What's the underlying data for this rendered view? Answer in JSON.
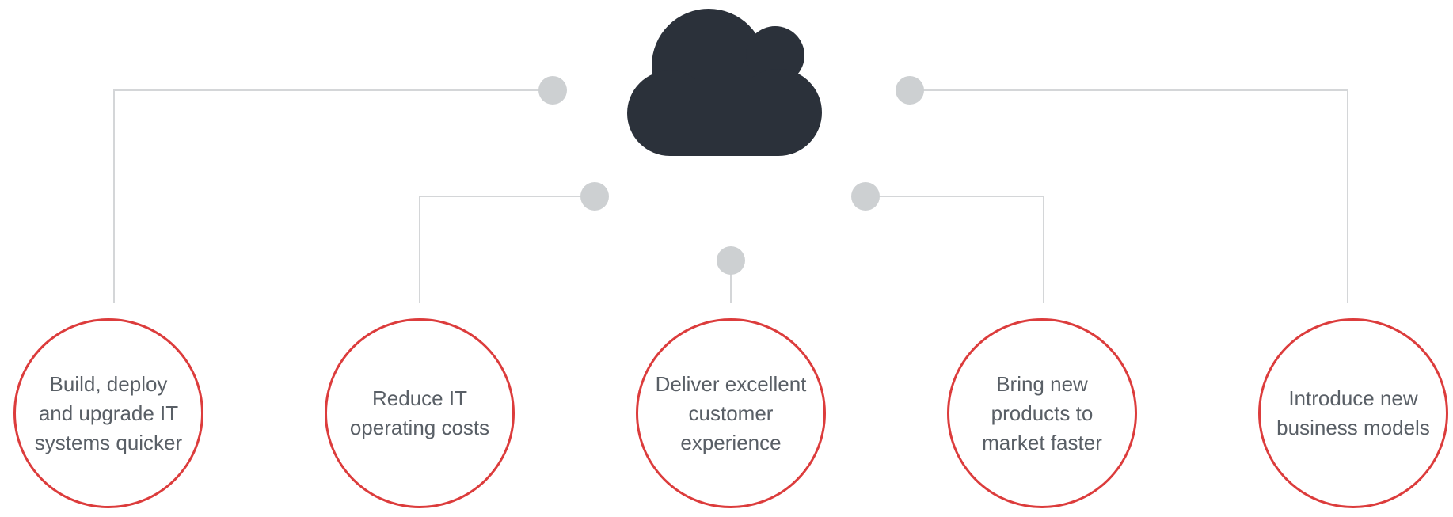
{
  "colors": {
    "cloud": "#2b313a",
    "connector_line": "#d4d6d8",
    "connector_dot": "#cdd0d2",
    "circle_border": "#dc3c3c",
    "text": "#595f66"
  },
  "center_icon": "cloud-icon",
  "benefits": [
    {
      "label": "Build, deploy\nand upgrade IT\nsystems quicker"
    },
    {
      "label": "Reduce IT\noperating costs"
    },
    {
      "label": "Deliver excellent\ncustomer\nexperience"
    },
    {
      "label": "Bring new\nproducts to\nmarket faster"
    },
    {
      "label": "Introduce new\nbusiness models"
    }
  ]
}
